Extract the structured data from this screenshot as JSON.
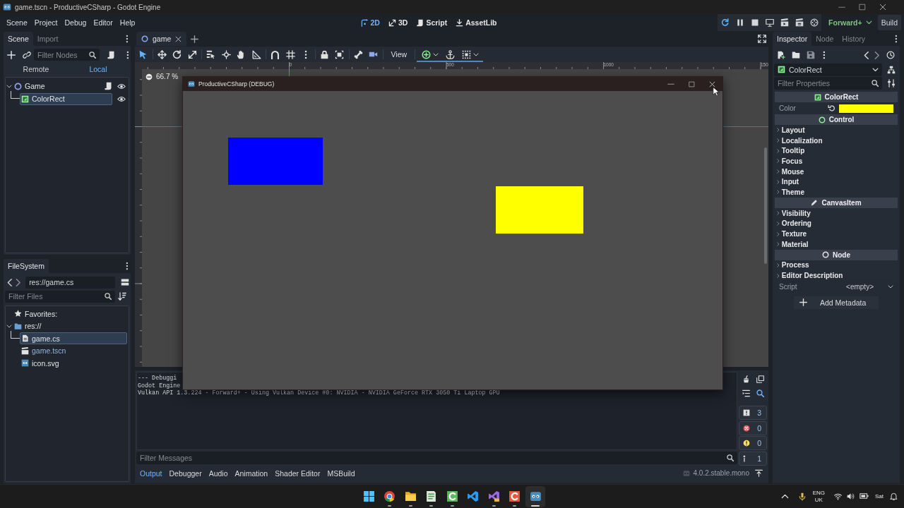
{
  "title_bar": {
    "title": "game.tscn - ProductiveCSharp - Godot Engine"
  },
  "main_bar": {
    "menu": [
      "Scene",
      "Project",
      "Debug",
      "Editor",
      "Help"
    ],
    "workspaces": [
      {
        "label": "2D",
        "kind": "canvas",
        "selected": true
      },
      {
        "label": "3D",
        "kind": "spatial",
        "selected": false
      },
      {
        "label": "Script",
        "kind": "script",
        "selected": false
      },
      {
        "label": "AssetLib",
        "kind": "assetlib",
        "selected": false
      }
    ],
    "run_buttons": [
      {
        "kind": "restart",
        "active": true
      },
      {
        "kind": "pause",
        "active": false
      },
      {
        "kind": "stop",
        "active": false
      },
      {
        "kind": "remote",
        "active": false
      },
      {
        "kind": "current",
        "active": false
      },
      {
        "kind": "custom",
        "active": false
      },
      {
        "kind": "movie",
        "active": false
      }
    ],
    "renderer": "Forward+",
    "build": "Build"
  },
  "scene_dock": {
    "tabs": [
      {
        "label": "Scene",
        "selected": true
      },
      {
        "label": "Import",
        "selected": false
      }
    ],
    "filter": {
      "placeholder": "Filter Nodes"
    },
    "modes": [
      {
        "label": "Remote",
        "selected": false
      },
      {
        "label": "Local",
        "selected": true
      }
    ],
    "tree": [
      {
        "name": "Game",
        "kind": "node2d",
        "expanded": true,
        "selected": false,
        "has_script": true,
        "visible": true,
        "children": [
          {
            "name": "ColorRect",
            "kind": "colorrect",
            "selected": true,
            "has_script": false,
            "visible": true
          }
        ]
      }
    ]
  },
  "filesystem_dock": {
    "tabs": [
      {
        "label": "FileSystem",
        "selected": true
      }
    ],
    "path": "res://game.cs",
    "filter": {
      "placeholder": "Filter Files"
    },
    "favorites": "Favorites:",
    "tree": [
      {
        "name": "res://",
        "kind": "folder",
        "expanded": true,
        "selected": false,
        "children": [
          {
            "name": "game.cs",
            "kind": "script",
            "selected": true
          },
          {
            "name": "game.tscn",
            "kind": "scene",
            "selected": false
          },
          {
            "name": "icon.svg",
            "kind": "image",
            "selected": false
          }
        ]
      }
    ]
  },
  "scene_tabs": [
    {
      "label": "game",
      "selected": true
    }
  ],
  "canvas_toolbar": {
    "tool_groups": [
      [
        {
          "kind": "select",
          "selected": true
        }
      ],
      [
        {
          "kind": "move",
          "selected": false
        },
        {
          "kind": "rotate",
          "selected": false
        },
        {
          "kind": "scale",
          "selected": false
        }
      ],
      [
        {
          "kind": "listselect",
          "selected": false
        },
        {
          "kind": "pivot",
          "selected": false
        },
        {
          "kind": "pan",
          "selected": false
        },
        {
          "kind": "ruler",
          "selected": false
        }
      ],
      [
        {
          "kind": "smartsnap",
          "selected": false
        },
        {
          "kind": "gridsnap",
          "selected": false
        },
        {
          "kind": "more",
          "selected": false
        }
      ],
      [
        {
          "kind": "lock",
          "selected": false
        },
        {
          "kind": "group",
          "selected": false
        }
      ],
      [
        {
          "kind": "bone",
          "selected": false
        },
        {
          "kind": "camera",
          "selected": false
        }
      ]
    ],
    "view_menu": "View",
    "node_tools": [
      {
        "kind": "add"
      },
      {
        "kind": "anchor"
      },
      {
        "kind": "layout"
      }
    ]
  },
  "viewport": {
    "zoom": "66.7 %",
    "ruler_labels": [
      "0",
      "500",
      "1000",
      "150"
    ]
  },
  "game_window": {
    "title": "ProductiveCSharp (DEBUG)",
    "rects": [
      {
        "color": "#0000ff"
      },
      {
        "color": "#ffff00"
      }
    ]
  },
  "bottom_panel": {
    "output_lines": [
      "--- Debuggi",
      "Godot Engine",
      "Vulkan API 1.3.224 - Forward+ - Using Vulkan Device #0: NVIDIA - NVIDIA GeForce RTX 3050 Ti Laptop GPU"
    ],
    "filter": {
      "placeholder": "Filter Messages"
    },
    "toggles": [
      {
        "kind": "message",
        "count": "3",
        "on": true
      },
      {
        "kind": "error",
        "count": "0",
        "on": true
      },
      {
        "kind": "warning",
        "count": "0",
        "on": true
      },
      {
        "kind": "editor",
        "count": "1",
        "on": true
      }
    ],
    "tabs": [
      {
        "label": "Output",
        "selected": true
      },
      {
        "label": "Debugger",
        "selected": false
      },
      {
        "label": "Audio",
        "selected": false
      },
      {
        "label": "Animation",
        "selected": false
      },
      {
        "label": "Shader Editor",
        "selected": false
      },
      {
        "label": "MSBuild",
        "selected": false
      }
    ],
    "version": "4.0.2.stable.mono"
  },
  "inspector": {
    "tabs": [
      {
        "label": "Inspector",
        "selected": true
      },
      {
        "label": "Node",
        "selected": false
      },
      {
        "label": "History",
        "selected": false
      }
    ],
    "object": {
      "label": "ColorRect",
      "kind": "colorrect"
    },
    "filter": {
      "placeholder": "Filter Properties"
    },
    "categories": [
      {
        "label": "ColorRect",
        "kind": "colorrect",
        "rows": [
          {
            "kind": "color",
            "label": "Color",
            "color": "#ffff00"
          }
        ]
      },
      {
        "label": "Control",
        "kind": "control",
        "rows": [
          {
            "kind": "section",
            "label": "Layout"
          },
          {
            "kind": "section",
            "label": "Localization"
          },
          {
            "kind": "section",
            "label": "Tooltip"
          },
          {
            "kind": "section",
            "label": "Focus"
          },
          {
            "kind": "section",
            "label": "Mouse"
          },
          {
            "kind": "section",
            "label": "Input"
          },
          {
            "kind": "section",
            "label": "Theme"
          }
        ]
      },
      {
        "label": "CanvasItem",
        "kind": "canvasitem",
        "rows": [
          {
            "kind": "section",
            "label": "Visibility"
          },
          {
            "kind": "section",
            "label": "Ordering"
          },
          {
            "kind": "section",
            "label": "Texture"
          },
          {
            "kind": "section",
            "label": "Material"
          }
        ]
      },
      {
        "label": "Node",
        "kind": "node",
        "rows": [
          {
            "kind": "section",
            "label": "Process"
          },
          {
            "kind": "section",
            "label": "Editor Description"
          },
          {
            "kind": "resource",
            "label": "Script",
            "value": "<empty>"
          }
        ]
      }
    ],
    "add_metadata": "Add Metadata"
  },
  "taskbar": {
    "apps": [
      {
        "kind": "start",
        "running": false,
        "active": false
      },
      {
        "kind": "browser",
        "running": true,
        "active": false
      },
      {
        "kind": "folder",
        "running": true,
        "active": false
      },
      {
        "kind": "notepad",
        "running": true,
        "active": false
      },
      {
        "kind": "capture",
        "running": true,
        "active": false
      },
      {
        "kind": "code",
        "running": false,
        "active": false
      },
      {
        "kind": "studio",
        "running": true,
        "active": false
      },
      {
        "kind": "recorder",
        "running": true,
        "active": false
      },
      {
        "kind": "engine",
        "running": true,
        "active": true
      }
    ],
    "language": "ENG",
    "region": "UK",
    "day": "Sat"
  }
}
